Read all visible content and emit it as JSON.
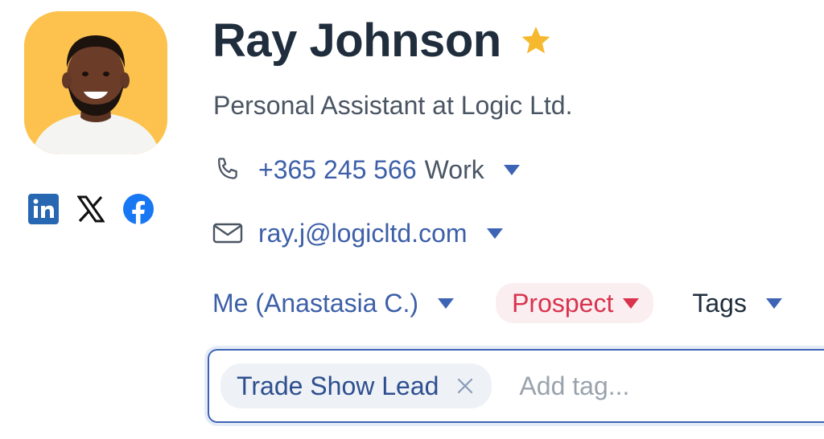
{
  "contact": {
    "name": "Ray Johnson",
    "job_title": "Personal Assistant at Logic Ltd.",
    "favorite": true
  },
  "phone": {
    "number": "+365 245 566",
    "type": "Work"
  },
  "email": {
    "address": "ray.j@logicltd.com"
  },
  "socials": [
    {
      "icon": "linkedin-icon"
    },
    {
      "icon": "x-icon"
    },
    {
      "icon": "facebook-icon"
    }
  ],
  "owner": {
    "label": "Me (Anastasia C.)"
  },
  "status": {
    "label": "Prospect",
    "color": "#d9334e"
  },
  "tags": {
    "dropdown_label": "Tags",
    "items": [
      {
        "label": "Trade Show Lead"
      }
    ],
    "input_placeholder": "Add tag..."
  },
  "colors": {
    "accent": "#3d64b4",
    "avatar_bg": "#fcc24d",
    "star": "#f5b82e"
  }
}
